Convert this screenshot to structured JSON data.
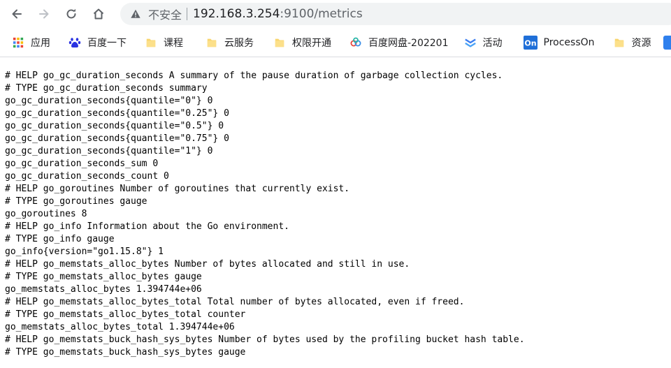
{
  "toolbar": {
    "security_label": "不安全",
    "url_host": "192.168.3.254",
    "url_rest": ":9100/metrics"
  },
  "bookmarks": [
    {
      "label": "应用",
      "icon": "apps-grid-icon"
    },
    {
      "label": "百度一下",
      "icon": "baidu-paw-icon"
    },
    {
      "label": "课程",
      "icon": "folder-icon"
    },
    {
      "label": "云服务",
      "icon": "folder-icon"
    },
    {
      "label": "权限开通",
      "icon": "folder-icon"
    },
    {
      "label": "百度网盘-202201",
      "icon": "baidu-netdisk-icon"
    },
    {
      "label": "活动",
      "icon": "chevron-logo-icon"
    },
    {
      "label": "ProcessOn",
      "icon": "processon-logo-icon"
    },
    {
      "label": "资源",
      "icon": "folder-icon"
    }
  ],
  "metrics_lines": [
    "# HELP go_gc_duration_seconds A summary of the pause duration of garbage collection cycles.",
    "# TYPE go_gc_duration_seconds summary",
    "go_gc_duration_seconds{quantile=\"0\"} 0",
    "go_gc_duration_seconds{quantile=\"0.25\"} 0",
    "go_gc_duration_seconds{quantile=\"0.5\"} 0",
    "go_gc_duration_seconds{quantile=\"0.75\"} 0",
    "go_gc_duration_seconds{quantile=\"1\"} 0",
    "go_gc_duration_seconds_sum 0",
    "go_gc_duration_seconds_count 0",
    "# HELP go_goroutines Number of goroutines that currently exist.",
    "# TYPE go_goroutines gauge",
    "go_goroutines 8",
    "# HELP go_info Information about the Go environment.",
    "# TYPE go_info gauge",
    "go_info{version=\"go1.15.8\"} 1",
    "# HELP go_memstats_alloc_bytes Number of bytes allocated and still in use.",
    "# TYPE go_memstats_alloc_bytes gauge",
    "go_memstats_alloc_bytes 1.394744e+06",
    "# HELP go_memstats_alloc_bytes_total Total number of bytes allocated, even if freed.",
    "# TYPE go_memstats_alloc_bytes_total counter",
    "go_memstats_alloc_bytes_total 1.394744e+06",
    "# HELP go_memstats_buck_hash_sys_bytes Number of bytes used by the profiling bucket hash table.",
    "# TYPE go_memstats_buck_hash_sys_bytes gauge"
  ]
}
